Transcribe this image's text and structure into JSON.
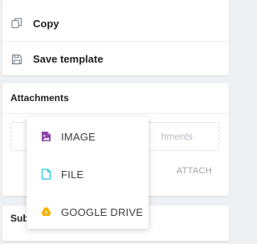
{
  "menu": {
    "items": [
      {
        "label": "Copy",
        "icon": "copy-icon"
      },
      {
        "label": "Save template",
        "icon": "save-template-icon"
      }
    ]
  },
  "attachments": {
    "title": "Attachments",
    "dropzone_text": "hments",
    "attach_label": "ATTACH"
  },
  "subject": {
    "title": "Sub"
  },
  "dropdown": {
    "options": [
      {
        "label": "IMAGE",
        "icon": "image-icon",
        "color": "#8e44ad"
      },
      {
        "label": "FILE",
        "icon": "file-icon",
        "color": "#26c6da"
      },
      {
        "label": "GOOGLE DRIVE",
        "icon": "google-drive-icon",
        "color": "#f4b400"
      }
    ]
  }
}
